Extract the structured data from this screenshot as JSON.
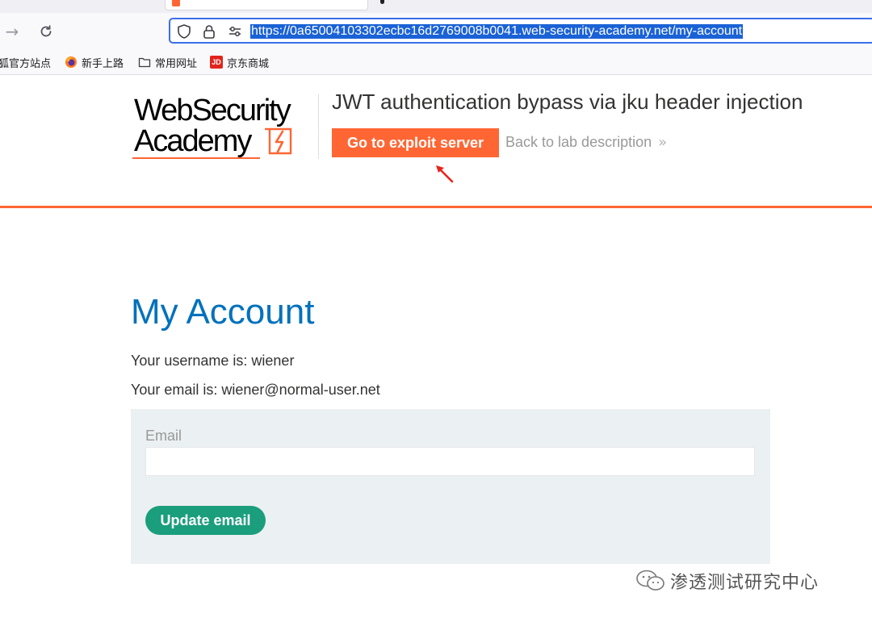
{
  "browser": {
    "url": "https://0a65004103302ecbc16d2769008b0041.web-security-academy.net/my-account",
    "bookmarks": [
      {
        "label": "狐官方站点",
        "icon": "firefox-icon"
      },
      {
        "label": "新手上路",
        "icon": "firefox-icon"
      },
      {
        "label": "常用网址",
        "icon": "folder-icon"
      },
      {
        "label": "京东商城",
        "icon": "jd-icon",
        "icon_text": "JD"
      }
    ]
  },
  "header": {
    "logo_line1": "WebSecurity",
    "logo_line2": "Academy",
    "lab_title": "JWT authentication bypass via jku header injection",
    "exploit_button": "Go to exploit server",
    "back_link": "Back to lab description",
    "back_chevron": "»"
  },
  "main": {
    "title": "My Account",
    "username_line": "Your username is: wiener",
    "email_line": "Your email is: wiener@normal-user.net",
    "form": {
      "email_label": "Email",
      "email_value": "",
      "submit_label": "Update email"
    }
  },
  "watermark": {
    "text": "渗透测试研究中心"
  },
  "colors": {
    "accent": "#ff6633",
    "title_blue": "#0071bc",
    "button_green": "#1a9e7c",
    "form_bg": "#ebf0f2",
    "url_selection": "#1a62d6"
  }
}
